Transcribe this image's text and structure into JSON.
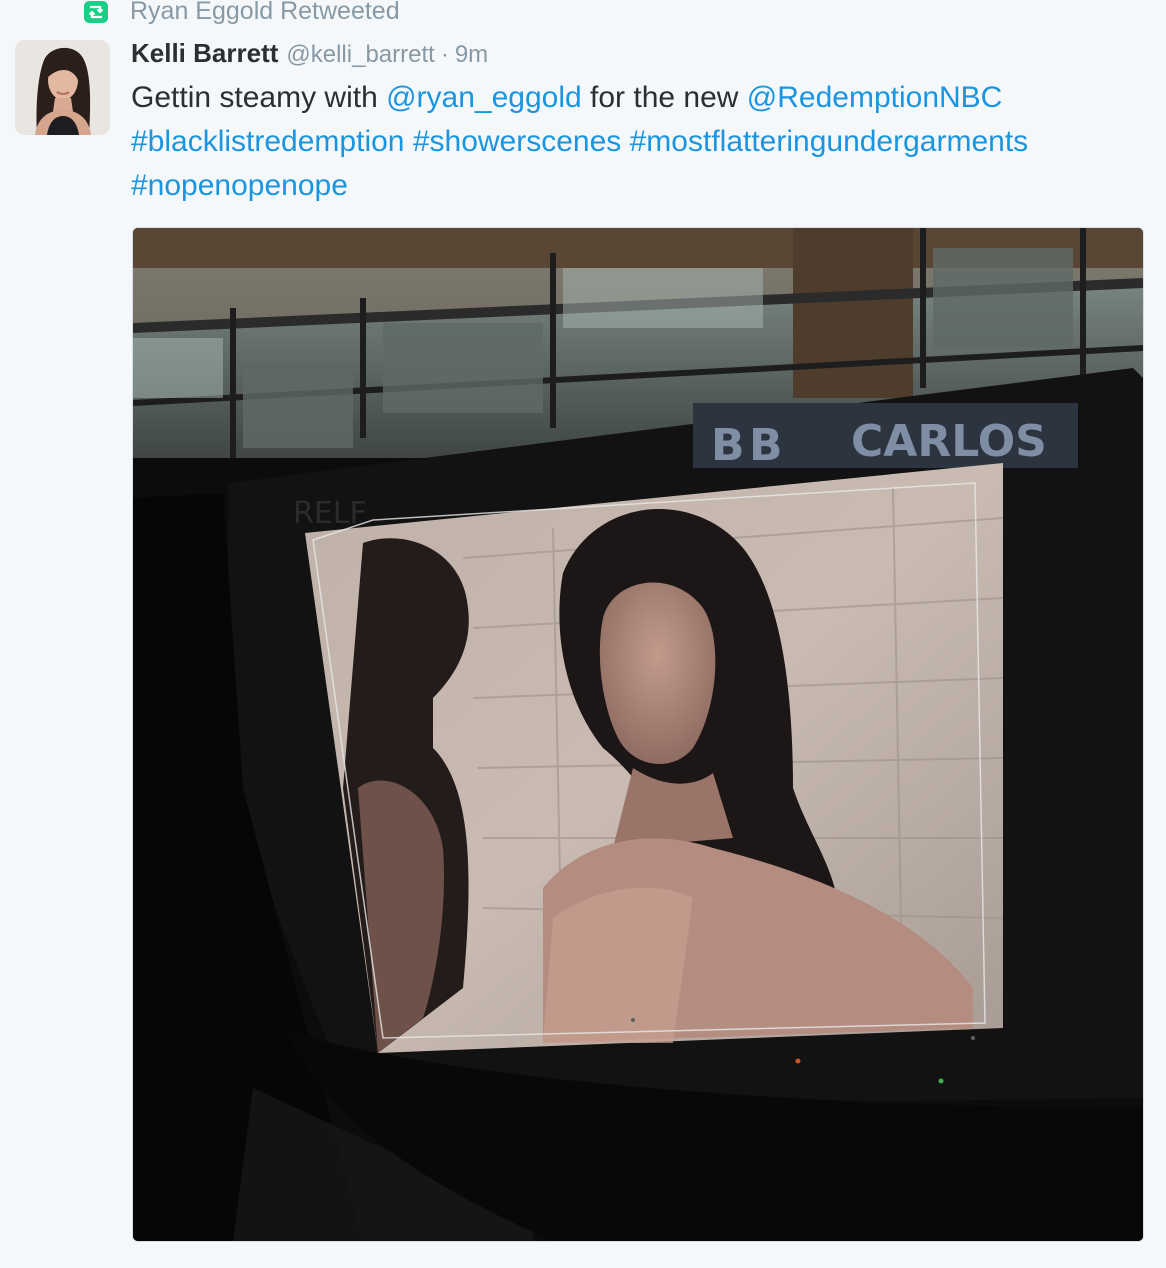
{
  "retweet_context": {
    "icon": "retweet-icon",
    "label": "Ryan Eggold Retweeted",
    "icon_color": "#19cf86"
  },
  "tweet": {
    "author": {
      "fullname": "Kelli Barrett",
      "username": "@kelli_barrett",
      "avatar": "avatar-photo"
    },
    "separator": "·",
    "timestamp": "9m",
    "text": {
      "part1": "Gettin steamy with ",
      "mention1": "@ryan_eggold",
      "part2": " for the new ",
      "mention2": "@RedemptionNBC",
      "hashtag1": "#blacklistredemption",
      "hashtag2": "#showerscenes",
      "hashtag3": "#mostflatteringundergarments",
      "hashtag4": "#nopenopenope"
    },
    "link_color": "#1b95e0",
    "media": {
      "description_icon": "photo-icon",
      "monitor_label": "CARLOS",
      "monitor_tag": "B",
      "bezel_text": "RELF"
    }
  }
}
